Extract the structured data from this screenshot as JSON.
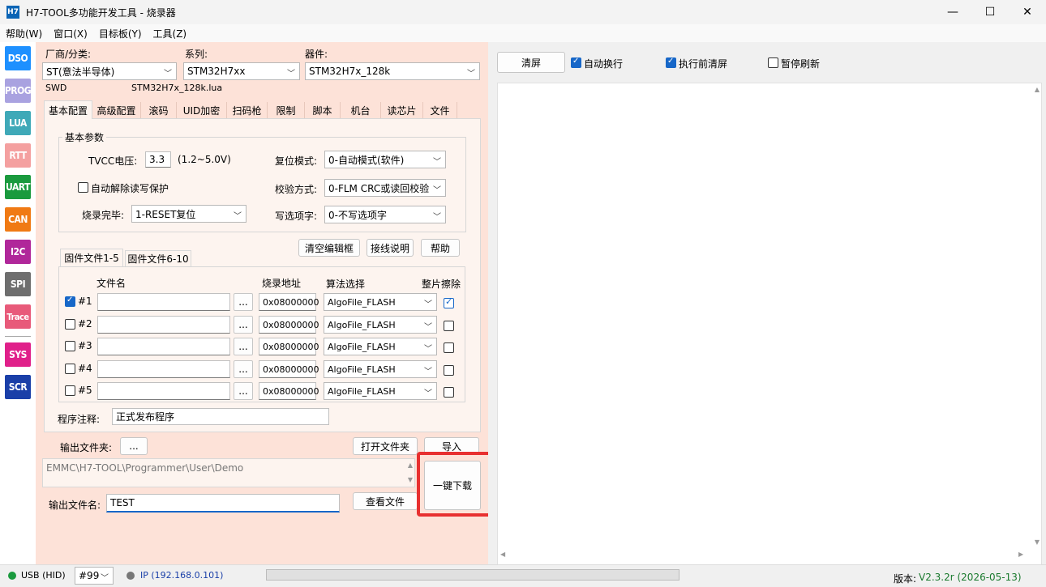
{
  "window": {
    "icon": "H7",
    "title": "H7-TOOL多功能开发工具 - 烧录器",
    "minimize": "—",
    "maximize": "☐",
    "close": "✕"
  },
  "menu": [
    "帮助(W)",
    "窗口(X)",
    "目标板(Y)",
    "工具(Z)"
  ],
  "toolbar": [
    {
      "label": "DSO",
      "color": "#1e90ff"
    },
    {
      "label": "PROG",
      "color": "#a9a2e0"
    },
    {
      "label": "LUA",
      "color": "#3fa9b8"
    },
    {
      "label": "RTT",
      "color": "#f4a0a0"
    },
    {
      "label": "UART",
      "color": "#1a9a3e"
    },
    {
      "label": "CAN",
      "color": "#f07a14"
    },
    {
      "label": "I2C",
      "color": "#b0279a"
    },
    {
      "label": "SPI",
      "color": "#6e6e6e"
    },
    {
      "label": "Trace",
      "color": "#e85a7a"
    },
    {
      "label": "SYS",
      "color": "#e0208a"
    },
    {
      "label": "SCR",
      "color": "#1a3fa8"
    }
  ],
  "device": {
    "vendor_label": "厂商/分类:",
    "vendor": "ST(意法半导体)",
    "series_label": "系列:",
    "series": "STM32H7xx",
    "part_label": "器件:",
    "part": "STM32H7x_128k",
    "interface": "SWD",
    "lua_file": "STM32H7x_128k.lua"
  },
  "tabs": [
    "基本配置",
    "高级配置",
    "滚码",
    "UID加密",
    "扫码枪",
    "限制",
    "脚本",
    "机台",
    "读芯片",
    "文件"
  ],
  "basic": {
    "group_title": "基本参数",
    "tvcc_label": "TVCC电压:",
    "tvcc_value": "3.3",
    "tvcc_range": "(1.2~5.0V)",
    "reset_label": "复位模式:",
    "reset_value": "0-自动模式(软件)",
    "unlock_label": "自动解除读写保护",
    "verify_label": "校验方式:",
    "verify_value": "0-FLM CRC或读回校验",
    "done_label": "烧录完毕:",
    "done_value": "1-RESET复位",
    "option_label": "写选项字:",
    "option_value": "0-不写选项字"
  },
  "buttons": {
    "clear_editor": "清空编辑框",
    "wiring": "接线说明",
    "help": "帮助",
    "browse": "...",
    "open_folder": "打开文件夹",
    "import": "导入",
    "view_file": "查看文件",
    "one_click": "一键下载",
    "clear_screen": "清屏"
  },
  "firmware": {
    "subtabs": [
      "固件文件1-5",
      "固件文件6-10"
    ],
    "col_file": "文件名",
    "col_addr": "烧录地址",
    "col_algo": "算法选择",
    "col_erase": "整片擦除",
    "rows": [
      {
        "id": "#1",
        "checked": true,
        "file": "",
        "addr": "0x08000000",
        "algo": "AlgoFile_FLASH",
        "erase": true
      },
      {
        "id": "#2",
        "checked": false,
        "file": "",
        "addr": "0x08000000",
        "algo": "AlgoFile_FLASH",
        "erase": false
      },
      {
        "id": "#3",
        "checked": false,
        "file": "",
        "addr": "0x08000000",
        "algo": "AlgoFile_FLASH",
        "erase": false
      },
      {
        "id": "#4",
        "checked": false,
        "file": "",
        "addr": "0x08000000",
        "algo": "AlgoFile_FLASH",
        "erase": false
      },
      {
        "id": "#5",
        "checked": false,
        "file": "",
        "addr": "0x08000000",
        "algo": "AlgoFile_FLASH",
        "erase": false
      }
    ]
  },
  "note": {
    "label": "程序注释:",
    "value": "正式发布程序"
  },
  "output": {
    "folder_label": "输出文件夹:",
    "folder_path": "EMMC\\H7-TOOL\\Programmer\\User\\Demo",
    "name_label": "输出文件名:",
    "name_value": "TEST"
  },
  "log": {
    "auto_wrap": "自动换行",
    "auto_wrap_checked": true,
    "clear_before": "执行前清屏",
    "clear_before_checked": true,
    "pause": "暂停刷新",
    "pause_checked": false,
    "scroll_up": "▲",
    "scroll_down": "▼",
    "scroll_left": "◀",
    "scroll_right": "▶"
  },
  "status": {
    "usb": "USB (HID)",
    "usb_color": "#1a9a3e",
    "device_no": "#99",
    "ip": "IP (192.168.0.101)",
    "ip_color": "#777777",
    "version_label": "版本:",
    "version": "V2.3.2r (2026-05-13)",
    "version_color": "#1a7a2e"
  },
  "highlight_color": "#e83030"
}
